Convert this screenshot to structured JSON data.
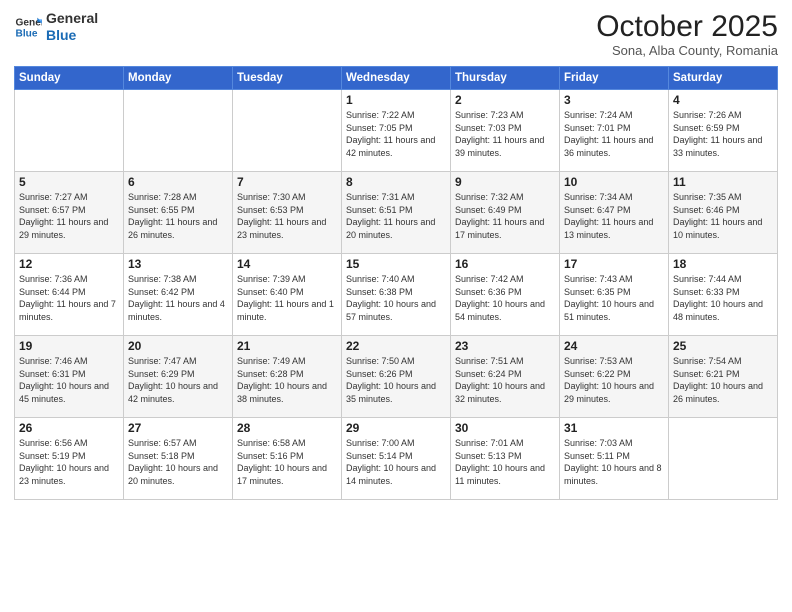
{
  "logo": {
    "line1": "General",
    "line2": "Blue"
  },
  "header": {
    "month": "October 2025",
    "location": "Sona, Alba County, Romania"
  },
  "days_of_week": [
    "Sunday",
    "Monday",
    "Tuesday",
    "Wednesday",
    "Thursday",
    "Friday",
    "Saturday"
  ],
  "weeks": [
    [
      {
        "day": "",
        "info": ""
      },
      {
        "day": "",
        "info": ""
      },
      {
        "day": "",
        "info": ""
      },
      {
        "day": "1",
        "info": "Sunrise: 7:22 AM\nSunset: 7:05 PM\nDaylight: 11 hours and 42 minutes."
      },
      {
        "day": "2",
        "info": "Sunrise: 7:23 AM\nSunset: 7:03 PM\nDaylight: 11 hours and 39 minutes."
      },
      {
        "day": "3",
        "info": "Sunrise: 7:24 AM\nSunset: 7:01 PM\nDaylight: 11 hours and 36 minutes."
      },
      {
        "day": "4",
        "info": "Sunrise: 7:26 AM\nSunset: 6:59 PM\nDaylight: 11 hours and 33 minutes."
      }
    ],
    [
      {
        "day": "5",
        "info": "Sunrise: 7:27 AM\nSunset: 6:57 PM\nDaylight: 11 hours and 29 minutes."
      },
      {
        "day": "6",
        "info": "Sunrise: 7:28 AM\nSunset: 6:55 PM\nDaylight: 11 hours and 26 minutes."
      },
      {
        "day": "7",
        "info": "Sunrise: 7:30 AM\nSunset: 6:53 PM\nDaylight: 11 hours and 23 minutes."
      },
      {
        "day": "8",
        "info": "Sunrise: 7:31 AM\nSunset: 6:51 PM\nDaylight: 11 hours and 20 minutes."
      },
      {
        "day": "9",
        "info": "Sunrise: 7:32 AM\nSunset: 6:49 PM\nDaylight: 11 hours and 17 minutes."
      },
      {
        "day": "10",
        "info": "Sunrise: 7:34 AM\nSunset: 6:47 PM\nDaylight: 11 hours and 13 minutes."
      },
      {
        "day": "11",
        "info": "Sunrise: 7:35 AM\nSunset: 6:46 PM\nDaylight: 11 hours and 10 minutes."
      }
    ],
    [
      {
        "day": "12",
        "info": "Sunrise: 7:36 AM\nSunset: 6:44 PM\nDaylight: 11 hours and 7 minutes."
      },
      {
        "day": "13",
        "info": "Sunrise: 7:38 AM\nSunset: 6:42 PM\nDaylight: 11 hours and 4 minutes."
      },
      {
        "day": "14",
        "info": "Sunrise: 7:39 AM\nSunset: 6:40 PM\nDaylight: 11 hours and 1 minute."
      },
      {
        "day": "15",
        "info": "Sunrise: 7:40 AM\nSunset: 6:38 PM\nDaylight: 10 hours and 57 minutes."
      },
      {
        "day": "16",
        "info": "Sunrise: 7:42 AM\nSunset: 6:36 PM\nDaylight: 10 hours and 54 minutes."
      },
      {
        "day": "17",
        "info": "Sunrise: 7:43 AM\nSunset: 6:35 PM\nDaylight: 10 hours and 51 minutes."
      },
      {
        "day": "18",
        "info": "Sunrise: 7:44 AM\nSunset: 6:33 PM\nDaylight: 10 hours and 48 minutes."
      }
    ],
    [
      {
        "day": "19",
        "info": "Sunrise: 7:46 AM\nSunset: 6:31 PM\nDaylight: 10 hours and 45 minutes."
      },
      {
        "day": "20",
        "info": "Sunrise: 7:47 AM\nSunset: 6:29 PM\nDaylight: 10 hours and 42 minutes."
      },
      {
        "day": "21",
        "info": "Sunrise: 7:49 AM\nSunset: 6:28 PM\nDaylight: 10 hours and 38 minutes."
      },
      {
        "day": "22",
        "info": "Sunrise: 7:50 AM\nSunset: 6:26 PM\nDaylight: 10 hours and 35 minutes."
      },
      {
        "day": "23",
        "info": "Sunrise: 7:51 AM\nSunset: 6:24 PM\nDaylight: 10 hours and 32 minutes."
      },
      {
        "day": "24",
        "info": "Sunrise: 7:53 AM\nSunset: 6:22 PM\nDaylight: 10 hours and 29 minutes."
      },
      {
        "day": "25",
        "info": "Sunrise: 7:54 AM\nSunset: 6:21 PM\nDaylight: 10 hours and 26 minutes."
      }
    ],
    [
      {
        "day": "26",
        "info": "Sunrise: 6:56 AM\nSunset: 5:19 PM\nDaylight: 10 hours and 23 minutes."
      },
      {
        "day": "27",
        "info": "Sunrise: 6:57 AM\nSunset: 5:18 PM\nDaylight: 10 hours and 20 minutes."
      },
      {
        "day": "28",
        "info": "Sunrise: 6:58 AM\nSunset: 5:16 PM\nDaylight: 10 hours and 17 minutes."
      },
      {
        "day": "29",
        "info": "Sunrise: 7:00 AM\nSunset: 5:14 PM\nDaylight: 10 hours and 14 minutes."
      },
      {
        "day": "30",
        "info": "Sunrise: 7:01 AM\nSunset: 5:13 PM\nDaylight: 10 hours and 11 minutes."
      },
      {
        "day": "31",
        "info": "Sunrise: 7:03 AM\nSunset: 5:11 PM\nDaylight: 10 hours and 8 minutes."
      },
      {
        "day": "",
        "info": ""
      }
    ]
  ]
}
